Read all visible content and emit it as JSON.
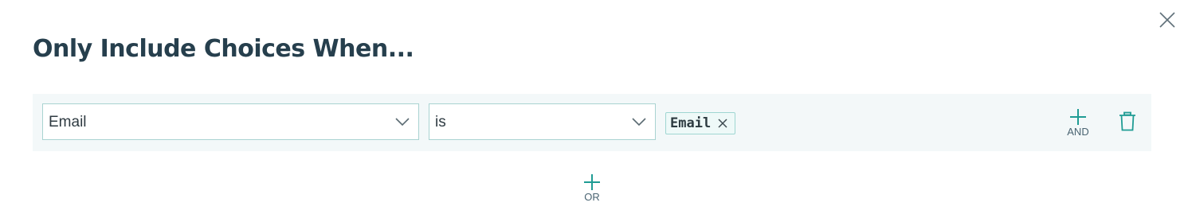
{
  "dialog": {
    "title": "Only Include Choices When..."
  },
  "condition": {
    "field": "Email",
    "operator": "is",
    "values": [
      "Email"
    ]
  },
  "actions": {
    "and_label": "AND",
    "or_label": "OR"
  },
  "icons": {
    "close": "close-icon",
    "dropdown": "chevron-down-icon",
    "remove_value": "close-icon",
    "add": "plus-icon",
    "delete": "trash-icon"
  },
  "colors": {
    "accent": "#1f9c94",
    "title": "#263f4d",
    "row_background": "#f3f8f9",
    "input_border": "#a9d3d1",
    "chip_background": "#eef9f8"
  }
}
